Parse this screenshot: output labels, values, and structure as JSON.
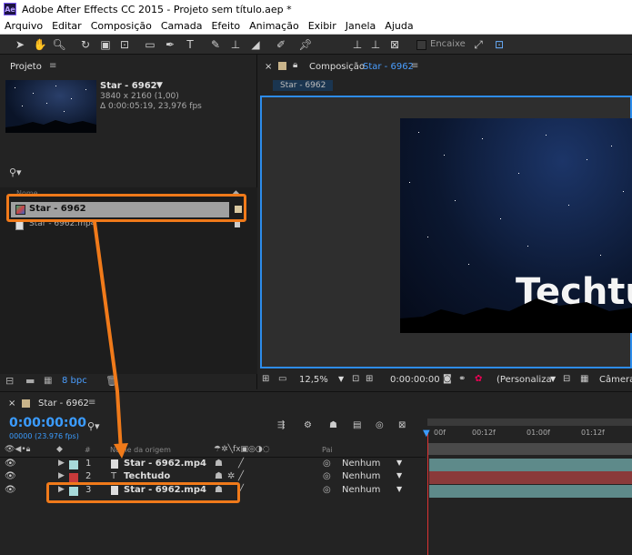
{
  "window": {
    "app_icon": "Ae",
    "title": "Adobe After Effects CC 2015 - Projeto sem título.aep *"
  },
  "menu": [
    "Arquivo",
    "Editar",
    "Composição",
    "Camada",
    "Efeito",
    "Animação",
    "Exibir",
    "Janela",
    "Ajuda"
  ],
  "toolbar": {
    "snap_label": "Encaixe"
  },
  "project": {
    "tab": "Projeto",
    "selected_name": "Star - 6962",
    "resolution": "3840 x 2160 (1,00)",
    "duration": "Δ 0:00:05:19, 23,976 fps",
    "column_name": "Nome",
    "items": [
      {
        "name": "Star - 6962"
      },
      {
        "name": "Star - 6962.mp4"
      }
    ],
    "bpc": "8 bpc"
  },
  "composition": {
    "tab_label": "Composição",
    "tab_comp": "Star - 6962",
    "chip": "Star - 6962",
    "overlay_text": "Techtu",
    "zoom": "12,5%",
    "timecode": "0:00:00:00",
    "view_mode": "(Personaliza",
    "camera": "Câmera"
  },
  "timeline": {
    "tab": "Star - 6962",
    "timecode": "0:00:00:00",
    "frames": "00000 (23.976 fps)",
    "col_source": "Nome da origem",
    "col_parent": "Pai",
    "ruler": [
      "00f",
      "00:12f",
      "01:00f",
      "01:12f"
    ],
    "layers": [
      {
        "num": "1",
        "name": "Star - 6962.mp4",
        "parent": "Nenhum",
        "color": "#a6d9d9",
        "bar": "#5e8a8a"
      },
      {
        "num": "2",
        "name": "Techtudo",
        "parent": "Nenhum",
        "color": "#c83a3a",
        "bar": "#8a3a3a"
      },
      {
        "num": "3",
        "name": "Star - 6962.mp4",
        "parent": "Nenhum",
        "color": "#a6d9d9",
        "bar": "#5e8a8a"
      }
    ]
  },
  "colors": {
    "accent": "#2d8ceb",
    "annotation": "#f07a1a"
  }
}
